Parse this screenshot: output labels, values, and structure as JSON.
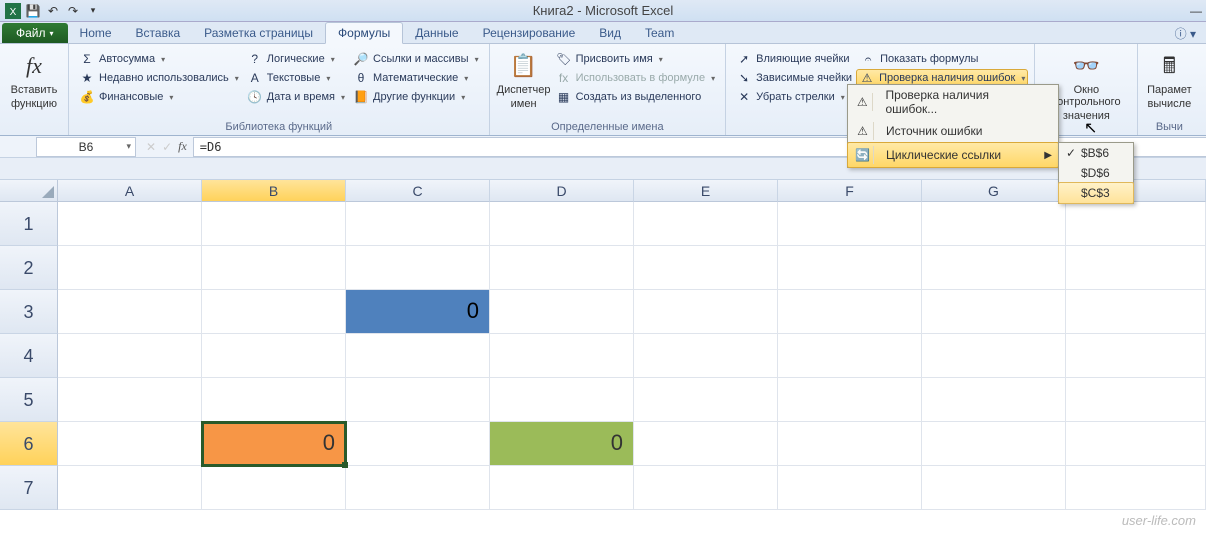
{
  "title": "Книга2 - Microsoft Excel",
  "tabs": {
    "file": "Файл",
    "items": [
      "Home",
      "Вставка",
      "Разметка страницы",
      "Формулы",
      "Данные",
      "Рецензирование",
      "Вид",
      "Team"
    ],
    "active_index": 3
  },
  "ribbon": {
    "insert_fn": {
      "line1": "Вставить",
      "line2": "функцию"
    },
    "lib_group": "Библиотека функций",
    "autosum": "Автосумма",
    "recent": "Недавно использовались",
    "financial": "Финансовые",
    "logical": "Логические",
    "text": "Текстовые",
    "datetime": "Дата и время",
    "lookup": "Ссылки и массивы",
    "math": "Математические",
    "more": "Другие функции",
    "name_mgr": {
      "line1": "Диспетчер",
      "line2": "имен"
    },
    "names_group": "Определенные имена",
    "define_name": "Присвоить имя",
    "use_in_formula": "Использовать в формуле",
    "create_from_sel": "Создать из выделенного",
    "trace_prec": "Влияющие ячейки",
    "trace_dep": "Зависимые ячейки",
    "remove_arrows": "Убрать стрелки",
    "show_formulas": "Показать формулы",
    "error_check": "Проверка наличия ошибок",
    "watch": {
      "line1": "Окно контрольного",
      "line2": "значения"
    },
    "calc_opts": {
      "line1": "Парамет",
      "line2": "вычисле"
    },
    "calc_group_partial": "Вычи"
  },
  "menu": {
    "error_check": "Проверка наличия ошибок...",
    "trace_error": "Источник ошибки",
    "circular": "Циклические ссылки",
    "refs": [
      "$B$6",
      "$D$6",
      "$C$3"
    ],
    "checked_index": 0,
    "hover_index": 2
  },
  "formula_bar": {
    "cell_ref": "B6",
    "formula": "=D6"
  },
  "grid": {
    "cols": [
      "A",
      "B",
      "C",
      "D",
      "E",
      "F",
      "G",
      ""
    ],
    "rows": [
      1,
      2,
      3,
      4,
      5,
      6,
      7
    ],
    "sel_col": "B",
    "sel_row": 6,
    "cells": {
      "C3": {
        "value": "0",
        "fill": "blue"
      },
      "B6": {
        "value": "0",
        "fill": "orange",
        "active": true
      },
      "D6": {
        "value": "0",
        "fill": "green"
      }
    }
  },
  "watermark": "user-life.com"
}
